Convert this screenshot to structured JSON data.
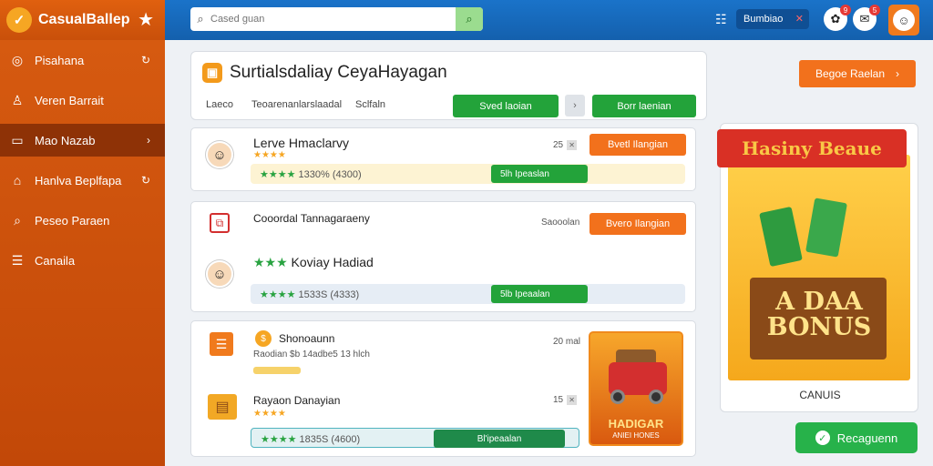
{
  "app": {
    "name": "CasualBallep",
    "logo_glyph": "✓"
  },
  "search": {
    "placeholder": "Cased guan"
  },
  "topbar": {
    "pill_label": "Bumbiao",
    "badge_1": "9",
    "badge_2": "5"
  },
  "sidebar": {
    "items": [
      {
        "label": "Pisahana",
        "icon": "compass-icon"
      },
      {
        "label": "Veren Barrait",
        "icon": "user-icon"
      },
      {
        "label": "Mao Nazab",
        "icon": "monitor-icon",
        "active": true
      },
      {
        "label": "Hanlva Beplfapa",
        "icon": "home-icon"
      },
      {
        "label": "Peseo Paraen",
        "icon": "search-icon"
      },
      {
        "label": "Canaila",
        "icon": "list-icon"
      }
    ]
  },
  "main": {
    "title": "Surtialsdaliay CeyaHayagan",
    "filters": [
      "Laeco",
      "Teoarenanlarslaadal",
      "Sclfaln"
    ],
    "btn_green_1": "Sved laoian",
    "btn_green_2": "Borr laenian",
    "btn_orange_top": "Begoe Raelan"
  },
  "cards": [
    {
      "name": "Lerve Hmaclarvy",
      "count": "25",
      "action": "Bvetl Ilangian",
      "stats": "1330% (4300)",
      "button": "5lh Ipeaslan"
    },
    {
      "heading": "Cooordal Tannagaraeny",
      "right_label": "Saooolan",
      "action": "Bvero Ilangian",
      "name": "Koviay Hadiad",
      "stats": "1533S (4333)",
      "button": "5lb Ipeaalan"
    },
    {
      "name": "Shonoaunn",
      "sub": "Raodian $b 14adbe5 13 hlch",
      "count": "20 mal",
      "name2": "Rayaon Danayian",
      "count2": "15",
      "stats": "1835S (4600)",
      "button": "Bl'ipeaalan"
    }
  ],
  "game_thumb": {
    "title": "HADIGAR",
    "sub": "ANIEI HONES"
  },
  "promo": {
    "ribbon": "Hasiny Beaue",
    "bonus_line1": "A DAA",
    "bonus_line2": "BONUS",
    "caption": "CANUIS",
    "cta": "Recaguenn"
  }
}
